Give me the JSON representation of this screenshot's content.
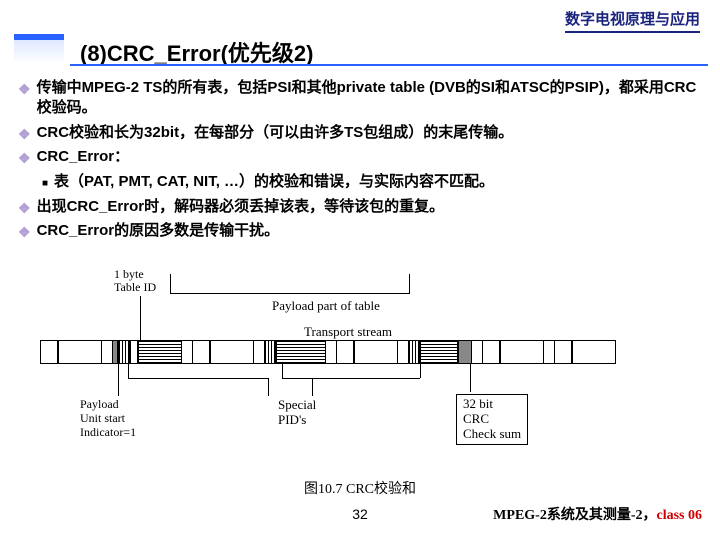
{
  "header": {
    "course": "数字电视原理与应用"
  },
  "title": "(8)CRC_Error(优先级2)",
  "bullets": [
    "传输中MPEG-2 TS的所有表，包括PSI和其他private table (DVB的SI和ATSC的PSIP)，都采用CRC校验码。",
    "CRC校验和长为32bit，在每部分（可以由许多TS包组成）的末尾传输。",
    "CRC_Error：",
    "出现CRC_Error时，解码器必须丢掉该表，等待该包的重复。",
    "CRC_Error的原因多数是传输干扰。"
  ],
  "subbullets": [
    "表（PAT, PMT, CAT, NIT, …）的校验和错误，与实际内容不匹配。"
  ],
  "diagram": {
    "tableid": "1 byte\nTable ID",
    "payload": "Payload part of table",
    "ts": "Transport stream",
    "pusi": "Payload\nUnit start\nIndicator=1",
    "spid": "Special\nPID's",
    "crc": "32 bit\nCRC\nCheck sum"
  },
  "caption": "图10.7 CRC校验和",
  "pagenum": "32",
  "footer": {
    "black": "MPEG-2系统及其测量-2，",
    "red": "class 06"
  }
}
